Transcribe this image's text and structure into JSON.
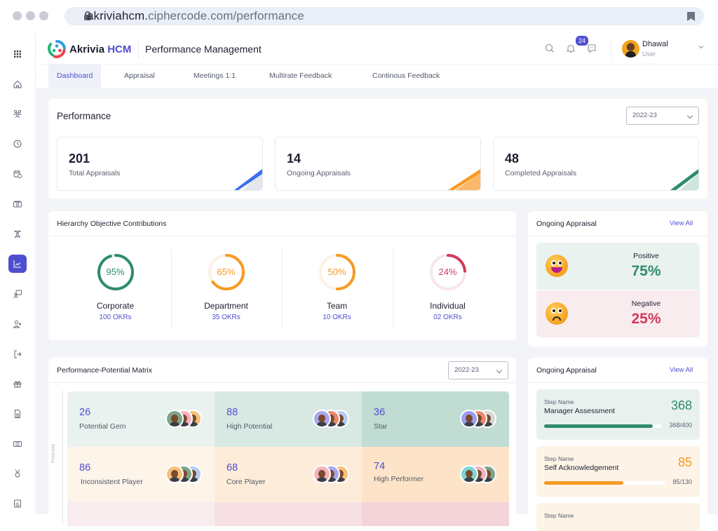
{
  "browser": {
    "url_host": "akriviahcm.",
    "url_rest": "ciphercode.com/performance"
  },
  "sidebar": {
    "items": [
      {
        "icon": "apps-grid-icon"
      },
      {
        "icon": "home-icon"
      },
      {
        "icon": "people-icon"
      },
      {
        "icon": "clock-icon"
      },
      {
        "icon": "calendar-clock-icon"
      },
      {
        "icon": "money-icon"
      },
      {
        "icon": "training-icon"
      },
      {
        "icon": "performance-chart-icon",
        "active": true
      },
      {
        "icon": "recruitment-icon"
      },
      {
        "icon": "add-user-icon"
      },
      {
        "icon": "exit-icon"
      },
      {
        "icon": "engagement-icon"
      },
      {
        "icon": "document-icon"
      },
      {
        "icon": "ticket-icon"
      },
      {
        "icon": "award-icon"
      },
      {
        "icon": "report-icon"
      }
    ]
  },
  "header": {
    "brand_name": "Akrivia",
    "brand_suffix": "HCM",
    "page_title": "Performance Management",
    "notification_count": "24",
    "user_name": "Dhawal",
    "user_role": "User"
  },
  "tabs": [
    {
      "label": "Dashboard",
      "active": true
    },
    {
      "label": "Appraisal"
    },
    {
      "label": "Meetings 1:1"
    },
    {
      "label": "Multirate Feedback"
    },
    {
      "label": "Continous Feedback"
    }
  ],
  "performance": {
    "title": "Performance",
    "year_select": "2022-23",
    "stats": [
      {
        "value": "201",
        "label": "Total Appraisals",
        "color": "#3a6ff0"
      },
      {
        "value": "14",
        "label": "Ongoing Appraisals",
        "color": "#f79a22"
      },
      {
        "value": "48",
        "label": "Completed Appraisals",
        "color": "#2e8c6e"
      }
    ]
  },
  "hierarchy": {
    "title": "Hierarchy Objective Contributions",
    "items": [
      {
        "percent": 95,
        "percent_label": "95%",
        "name": "Corporate",
        "count": "100 OKRs",
        "color": "#2e8c6e",
        "track": "#e6f1ed"
      },
      {
        "percent": 65,
        "percent_label": "65%",
        "name": "Department",
        "count": "35 OKRs",
        "color": "#f79a22",
        "track": "#fdf1e3"
      },
      {
        "percent": 50,
        "percent_label": "50%",
        "name": "Team",
        "count": "10 OKRs",
        "color": "#f79a22",
        "track": "#fdf1e3"
      },
      {
        "percent": 24,
        "percent_label": "24%",
        "name": "Individual",
        "count": "02 OKRs",
        "color": "#cf3b5a",
        "track": "#f7e6ea"
      }
    ]
  },
  "sentiment": {
    "title": "Ongoing Appraisal",
    "view_all": "View All",
    "positive_label": "Positive",
    "positive_value": "75%",
    "negative_label": "Negative",
    "negative_value": "25%"
  },
  "matrix": {
    "title": "Performance-Potential Matrix",
    "year_select": "2022-23",
    "axis_label": "Potential",
    "cells": [
      {
        "value": "26",
        "label": "Potential Gem",
        "bg": "#eaf2ef"
      },
      {
        "value": "88",
        "label": "High Potential",
        "bg": "#d8e9e3"
      },
      {
        "value": "36",
        "label": "Star",
        "bg": "#c0dcd3"
      },
      {
        "value": "86",
        "label": "Inconsistent Player",
        "bg": "#fdf4ea"
      },
      {
        "value": "68",
        "label": "Core Player",
        "bg": "#fdecd9"
      },
      {
        "value": "74",
        "label": "High Performer",
        "bg": "#fde4c8"
      }
    ]
  },
  "steps": {
    "title": "Ongoing Appraisal",
    "view_all": "View All",
    "items": [
      {
        "caption": "Step Name",
        "name": "Manager Assessment",
        "value": "368",
        "ratio": "368/400",
        "progress": 0.92,
        "color": "#2e8c6e",
        "bg": "#e9f1ee"
      },
      {
        "caption": "Step Name",
        "name": "Self Acknowledgement",
        "value": "85",
        "ratio": "85/130",
        "progress": 0.654,
        "color": "#f79a22",
        "bg": "#fdf3e7"
      },
      {
        "caption": "Step Name",
        "name": "",
        "value": "",
        "ratio": "",
        "progress": 0,
        "color": "#f79a22",
        "bg": "#fdf3e7"
      }
    ]
  }
}
